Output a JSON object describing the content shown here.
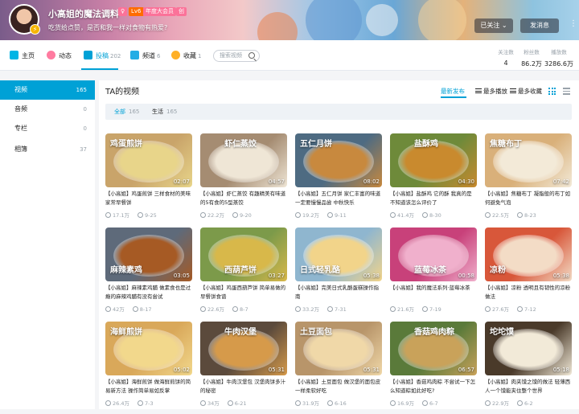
{
  "header": {
    "username": "小高姐的魔法调料",
    "level": "Lv6",
    "vip": "年度大会员",
    "badge": "创",
    "sign": "吃货给点赞，是否和我一样对食物有热爱?",
    "follow_label": "已关注",
    "follow_arrow": "⌄",
    "message_label": "发消息",
    "more_icon": "more-vertical-icon"
  },
  "nav": {
    "items": [
      {
        "label": "主页",
        "count": "",
        "icon": "home-icon",
        "color": "#00b5e5"
      },
      {
        "label": "动态",
        "count": "",
        "icon": "dynamic-icon",
        "color": "#ff7ba0"
      },
      {
        "label": "投稿",
        "count": "202",
        "icon": "video-upload-icon",
        "color": "#00a1d6"
      },
      {
        "label": "频道",
        "count": "6",
        "icon": "channel-icon",
        "color": "#23ade5"
      },
      {
        "label": "收藏",
        "count": "1",
        "icon": "star-icon",
        "color": "#ffb027"
      }
    ],
    "search_placeholder": "搜索视频",
    "stats": [
      {
        "label": "关注数",
        "value": "4"
      },
      {
        "label": "粉丝数",
        "value": "86.2万"
      },
      {
        "label": "播放数",
        "value": "3286.6万"
      }
    ]
  },
  "sidebar": {
    "items": [
      {
        "label": "视频",
        "count": "165"
      },
      {
        "label": "音频",
        "count": "0"
      },
      {
        "label": "专栏",
        "count": "0"
      },
      {
        "label": "相簿",
        "count": "37"
      }
    ]
  },
  "main": {
    "title": "TA的视频",
    "sorts": [
      "最新发布",
      "最多播放",
      "最多收藏"
    ],
    "filters": [
      {
        "label": "全部",
        "count": "165"
      },
      {
        "label": "生活",
        "count": "165"
      }
    ]
  },
  "videos": [
    {
      "title": "【小高姐】鸡蛋煎饼 三样食材的美味家常早餐饼",
      "plays": "17.1万",
      "date": "9-25",
      "duration": "02:07",
      "overlay": "鸡蛋煎饼",
      "bg": "#c9a46a",
      "fg": "#e8d58a"
    },
    {
      "title": "【小高姐】虾仁蒸饺 有趣精美有味道的5有食的5型蒸饺",
      "plays": "22.2万",
      "date": "9-20",
      "duration": "04:57",
      "overlay": "虾仁蒸饺",
      "bg": "#a58c72",
      "fg": "#efe6d6"
    },
    {
      "title": "【小高姐】五仁月饼 家仁丰富的味道一定要慢慢品尝 中秋快乐",
      "plays": "19.2万",
      "date": "9-11",
      "duration": "08:02",
      "overlay": "五仁月饼",
      "bg": "#4e6b82",
      "fg": "#c8893e"
    },
    {
      "title": "【小高姐】盐酥鸡 它的酥 我真的是不知道该怎么评价了",
      "plays": "41.4万",
      "date": "8-30",
      "duration": "04:30",
      "overlay": "盐酥鸡",
      "bg": "#6e8a3a",
      "fg": "#c98a2e"
    },
    {
      "title": "【小高姐】焦糖布丁 凝脂般的布丁如何避免气泡",
      "plays": "22.5万",
      "date": "8-23",
      "duration": "07:42",
      "overlay": "焦糖布丁",
      "bg": "#d9b07a",
      "fg": "#f3ead8"
    },
    {
      "title": "【小高姐】麻辣素鸡脯 做素食也是过瘾的麻辣鸡脯有没有尝试",
      "plays": "42万",
      "date": "8-17",
      "duration": "03:05",
      "overlay": "麻辣素鸡",
      "bg": "#5e6a7a",
      "fg": "#a65a24"
    },
    {
      "title": "【小高姐】鸡蛋西葫芦饼 简单易做的早餐饼食谱",
      "plays": "22.6万",
      "date": "8-7",
      "duration": "03:27",
      "overlay": "西葫芦饼",
      "bg": "#7c9a4a",
      "fg": "#d8b84a"
    },
    {
      "title": "【小高姐】完美日式乳酪蛋糕操作指南",
      "plays": "33.2万",
      "date": "7-31",
      "duration": "05:38",
      "overlay": "日式轻乳酪",
      "bg": "#8fb6cf",
      "fg": "#f2d48a"
    },
    {
      "title": "【小高姐】我的魔法系列·蓝莓冰茶",
      "plays": "21.6万",
      "date": "7-19",
      "duration": "00:58",
      "overlay": "蓝莓冰茶",
      "bg": "#c8417a",
      "fg": "#f0b0cc"
    },
    {
      "title": "【小高姐】凉粉 透明且有韧性的凉粉做法",
      "plays": "27.6万",
      "date": "7-12",
      "duration": "05:38",
      "overlay": "凉粉",
      "bg": "#d8573a",
      "fg": "#f3dcc6"
    },
    {
      "title": "【小高姐】海鲜煎饼 做海鲜煎饼的简易新方法 操作简单易如反掌",
      "plays": "26.4万",
      "date": "7-3",
      "duration": "05:02",
      "overlay": "海鲜煎饼",
      "bg": "#d9a85a",
      "fg": "#f2d88c"
    },
    {
      "title": "【小高姐】牛肉汉堡包 汉堡肉饼多汁的秘密",
      "plays": "34万",
      "date": "6-21",
      "duration": "05:31",
      "overlay": "牛肉汉堡",
      "bg": "#5b4a3c",
      "fg": "#d69a4a"
    },
    {
      "title": "【小高姐】土豆面包 做汉堡的面包皮 一样柔软好吃",
      "plays": "31.9万",
      "date": "6-16",
      "duration": "05:31",
      "overlay": "土豆面包",
      "bg": "#b8956a",
      "fg": "#f0d8a8"
    },
    {
      "title": "【小高姐】香菇鸡肉粽 不尝试一下怎么知道粽如此好吃?",
      "plays": "16.9万",
      "date": "6-7",
      "duration": "06:57",
      "overlay": "香菇鸡肉粽",
      "bg": "#5a7a3a",
      "fg": "#c9a25a"
    },
    {
      "title": "【小高姐】肉夹馍之馍的做法 轻薄西人一个馍能夹住整个世界",
      "plays": "22.9万",
      "date": "6-2",
      "duration": "05:18",
      "overlay": "坨坨馍",
      "bg": "#4a3a2a",
      "fg": "#f2ead8"
    }
  ]
}
